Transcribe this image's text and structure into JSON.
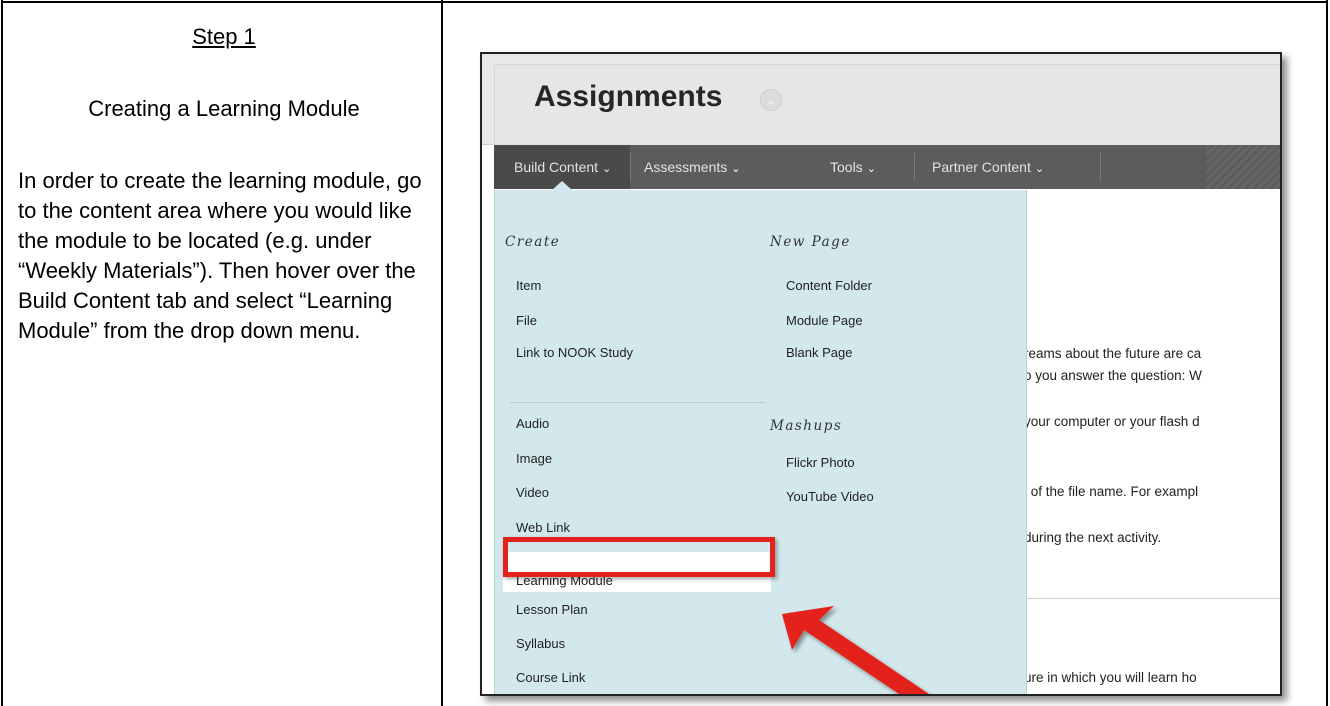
{
  "left_panel": {
    "step_title": "Step 1",
    "section_title": "Creating a Learning Module",
    "instruction": "In order to create the learning module, go to the content area where you would like the module to be located (e.g. under “Weekly Materials”). Then hover over the Build Content tab and select “Learning Module” from the drop down menu."
  },
  "screenshot": {
    "page_title": "Assignments",
    "title_icon": "chevron-down-circle-icon",
    "menu_tabs": [
      {
        "label": "Build Content"
      },
      {
        "label": "Assessments"
      },
      {
        "label": "Tools"
      },
      {
        "label": "Partner Content"
      }
    ],
    "dropdown": {
      "create_heading": "Create",
      "create_items": [
        "Item",
        "File",
        "Link to NOOK Study",
        "Audio",
        "Image",
        "Video",
        "Web Link",
        "Learning Module",
        "Lesson Plan",
        "Syllabus",
        "Course Link"
      ],
      "new_page_heading": "New Page",
      "new_page_items": [
        "Content Folder",
        "Module Page",
        "Blank Page"
      ],
      "mashups_heading": "Mashups",
      "mashups_items": [
        "Flickr Photo",
        "YouTube Video"
      ],
      "highlighted_item": "Learning Module"
    },
    "background_text": [
      "reams about the future are ca",
      "o you answer the question: W",
      "your computer or your flash d",
      "l of the file name. For exampl",
      "during the next activity.",
      "ure in which you will learn ho"
    ],
    "annotation_color": "#e3221c",
    "menu_bg_color": "#5c5c5c",
    "dropdown_bg_color": "#d2e8ec"
  }
}
